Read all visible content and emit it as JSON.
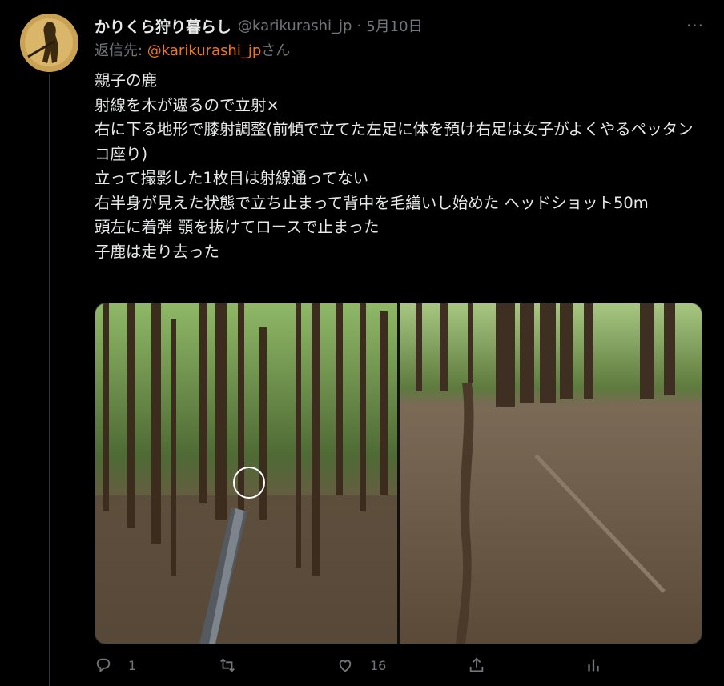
{
  "tweet": {
    "author_name": "かりくら狩り暮らし",
    "handle": "@karikurashi_jp",
    "separator": "·",
    "date": "5月10日",
    "more_label": "···",
    "reply_prefix": "返信先: ",
    "reply_mention": "@karikurashi_jp",
    "reply_suffix": "さん",
    "text": "親子の鹿\n射線を木が遮るので立射×\n右に下る地形で膝射調整(前傾で立てた左足に体を預け右足は女子がよくやるペッタンコ座り)\n立って撮影した1枚目は射線通ってない\n右半身が見えた状態で立ち止まって背中を毛繕いし始めた ヘッドショット50m\n頭左に着弾 顎を抜けてロースで止まった\n子鹿は走り去った"
  },
  "actions": {
    "reply_count": "1",
    "retweet_count": "",
    "like_count": "16"
  },
  "icons": {
    "reply": "reply-icon",
    "retweet": "retweet-icon",
    "like": "heart-icon",
    "share": "share-icon",
    "analytics": "analytics-icon"
  },
  "colors": {
    "background": "#000000",
    "text": "#e7e9ea",
    "muted": "#71767b",
    "mention": "#f1761c"
  }
}
